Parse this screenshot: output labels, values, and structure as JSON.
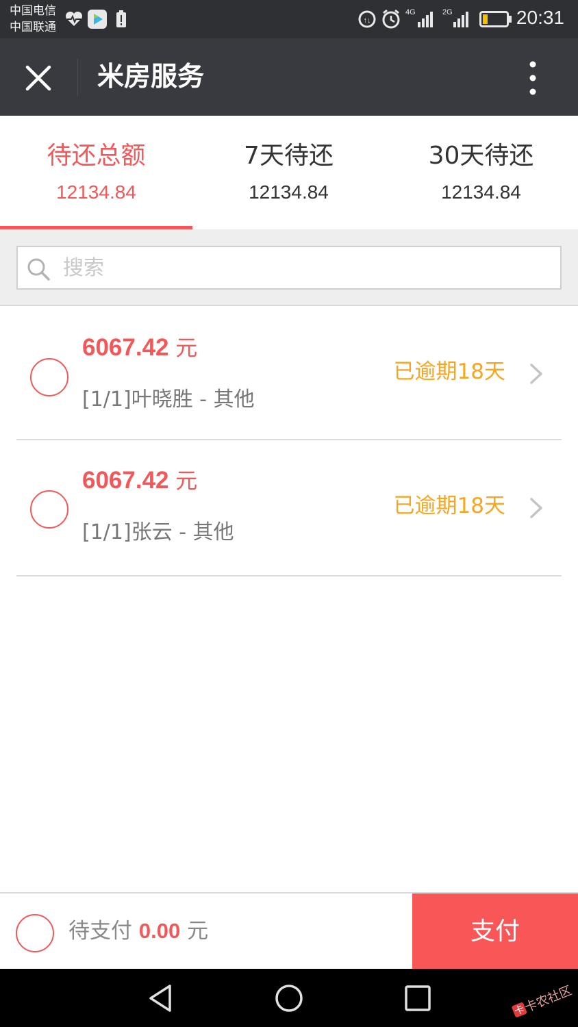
{
  "status_bar": {
    "carrier_1": "中国电信",
    "carrier_2": "中国联通",
    "time": "20:31",
    "signal_label_1": "4G",
    "signal_label_2": "2G"
  },
  "nav": {
    "title": "米房服务",
    "close_icon": "close-icon",
    "more_icon": "more-vertical-icon"
  },
  "tabs": [
    {
      "label": "待还总额",
      "value": "12134.84",
      "active": true
    },
    {
      "label": "7天待还",
      "value": "12134.84",
      "active": false
    },
    {
      "label": "30天待还",
      "value": "12134.84",
      "active": false
    }
  ],
  "search": {
    "placeholder": "搜索"
  },
  "items": [
    {
      "amount": "6067.42",
      "unit": "元",
      "description": "[1/1]叶晓胜 - 其他",
      "status": "已逾期18天"
    },
    {
      "amount": "6067.42",
      "unit": "元",
      "description": "[1/1]张云 - 其他",
      "status": "已逾期18天"
    }
  ],
  "bottom": {
    "pending_label": "待支付",
    "pending_amount": "0.00",
    "pending_unit": "元",
    "pay_label": "支付"
  },
  "watermark": "卡农社区",
  "colors": {
    "accent": "#f25859",
    "overdue": "#f5a623",
    "navbar": "#393a3f",
    "pay_button": "#f85657"
  }
}
